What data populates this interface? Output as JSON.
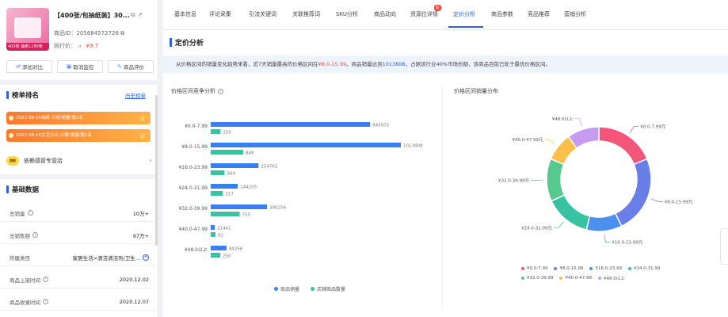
{
  "product": {
    "title": "【400张/包抽纸装】30...",
    "id_text": "商品ID：205684572726",
    "price_label": "同行价：",
    "price_value": "¥9.7",
    "image_ribbon": "400张 抽纸1280张"
  },
  "actions": [
    {
      "label": "添加对比",
      "icon": "compare-icon"
    },
    {
      "label": "取消监控",
      "icon": "monitor-icon"
    },
    {
      "label": "商品评价",
      "icon": "review-icon"
    }
  ],
  "ranking": {
    "title": "榜单排名",
    "history_link": "历史榜单",
    "bars": [
      "2022-09-16抽纸 日榜/销量/第2名",
      "2022-09-16生活日用 日榜/销量/第2名"
    ],
    "extra_item": "依赖感冒专营店",
    "extra_badge": "旗舰"
  },
  "basic": {
    "title": "基础数据",
    "rows": [
      {
        "label": "总销量",
        "value": "10万+"
      },
      {
        "label": "总销售额",
        "value": "97万+"
      },
      {
        "label": "所属类目",
        "value": "家居生活>清洁清洁剂/卫生..."
      },
      {
        "label": "商品上架时间",
        "value": "2020.12.02"
      },
      {
        "label": "商品收录时间",
        "value": "2020.12.07"
      }
    ]
  },
  "tabs": [
    {
      "label": "基本信息"
    },
    {
      "label": "评论采集"
    },
    {
      "label": "引流关键词"
    },
    {
      "label": "关联推荐词"
    },
    {
      "label": "SKU分析"
    },
    {
      "label": "商品动向"
    },
    {
      "label": "资源位详情"
    },
    {
      "label": "定价分析"
    },
    {
      "label": "商品参数"
    },
    {
      "label": "竞品推荐"
    },
    {
      "label": "营销分析"
    }
  ],
  "active_tab": "定价分析",
  "tab_new_badge": "新",
  "main": {
    "title": "定价分析",
    "info_prefix": "从价格区间的销量变化趋势来看，近7天销量最高的价格区间在",
    "info_range": "¥8.0-15.99",
    "info_mid": "。商品销量达到",
    "info_sales": "1013808",
    "info_suffix": "，占据该行业40%市场份额，该商品目前已处于最优价格区间。"
  },
  "bar_panel_title": "价格区间竞争分析",
  "donut_panel_title": "价格区间销量分布",
  "colors": {
    "accent": "#2f5fd9",
    "sales_bar": "#3a7ff0",
    "shops_bar": "#3ec1a3"
  },
  "chart_data": [
    {
      "type": "bar",
      "orientation": "horizontal",
      "categories": [
        "¥0.0-7.99",
        "¥8.0-15.99",
        "¥16.0-23.99",
        "¥24.0-31.99",
        "¥32.0-39.99",
        "¥40.0-47.99",
        "¥48.0以上"
      ],
      "series": [
        {
          "name": "商品销量",
          "values": [
            849503,
            1013808,
            254762,
            144205,
            300256,
            21441,
            84256
          ]
        },
        {
          "name": "店铺商品数量",
          "values": [
            256,
            848,
            360,
            317,
            755,
            92,
            250
          ]
        }
      ],
      "legend_position": "bottom"
    },
    {
      "type": "pie",
      "donut": true,
      "categories": [
        "¥0.0-7.99元",
        "¥8.0-15.99元",
        "¥16.0-23.99元",
        "¥24.0-31.99元",
        "¥32.0-39.99元",
        "¥40.0-47.99元",
        "¥48.0以上"
      ],
      "values": [
        17,
        22,
        10,
        13,
        12,
        8,
        9
      ],
      "colors": [
        "#f4557a",
        "#6a7ee8",
        "#4b8ff0",
        "#37c3a2",
        "#58c98e",
        "#fbbf4a",
        "#c79cf0"
      ],
      "legend_labels": [
        "¥0.0-7.99",
        "¥8.0-15.99",
        "¥16.0-23.99",
        "¥24.0-31.99",
        "¥32.0-39.99",
        "¥40.0-47.99",
        "¥48.0以上"
      ],
      "legend_position": "bottom"
    }
  ]
}
